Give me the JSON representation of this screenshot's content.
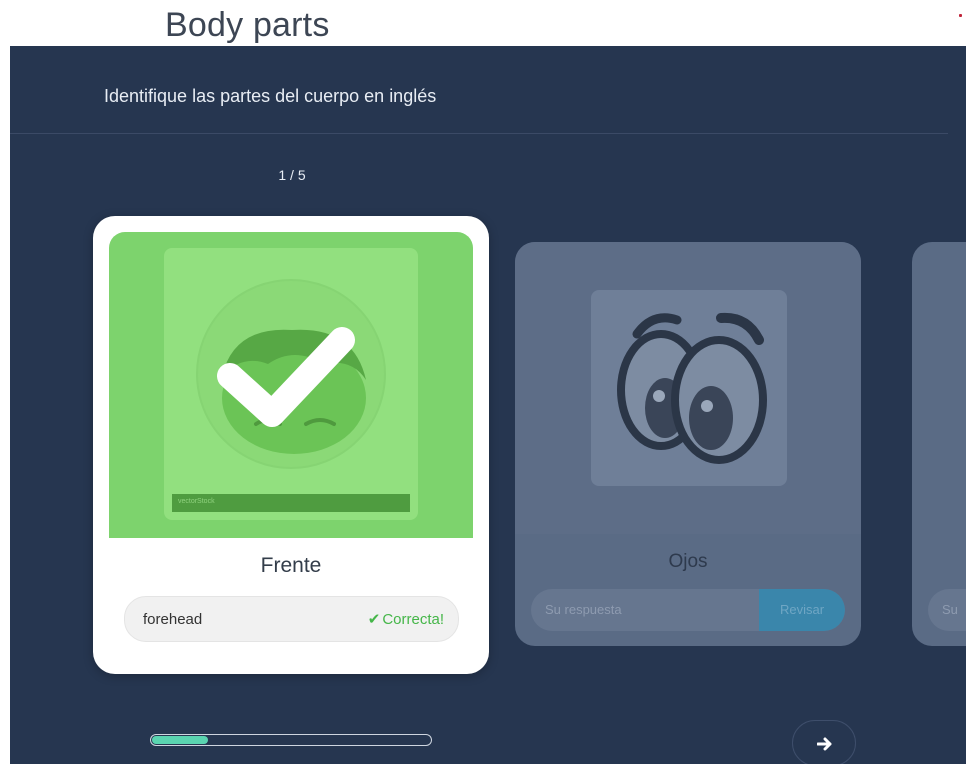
{
  "page": {
    "title": "Body parts"
  },
  "quiz": {
    "instruction": "Identifique las partes del cuerpo en inglés",
    "counter": "1 / 5",
    "progress": 0.2
  },
  "cards": [
    {
      "label": "Frente",
      "answer": "forehead",
      "result": "Correcta!",
      "result_icon": "check-icon",
      "image_watermark": "vectorStock",
      "state": "correct"
    },
    {
      "label": "Ojos",
      "placeholder": "Su respuesta",
      "check_label": "Revisar",
      "state": "inactive"
    },
    {
      "placeholder_partial": "Su",
      "state": "inactive"
    }
  ],
  "nav": {
    "next_icon": "arrow-right-icon"
  },
  "colors": {
    "panel_bg": "#263650",
    "correct_green": "#45b649",
    "card_image_green": "#7dd36d",
    "progress_fill": "#5ad4b0",
    "check_button": "#3a86ab"
  }
}
